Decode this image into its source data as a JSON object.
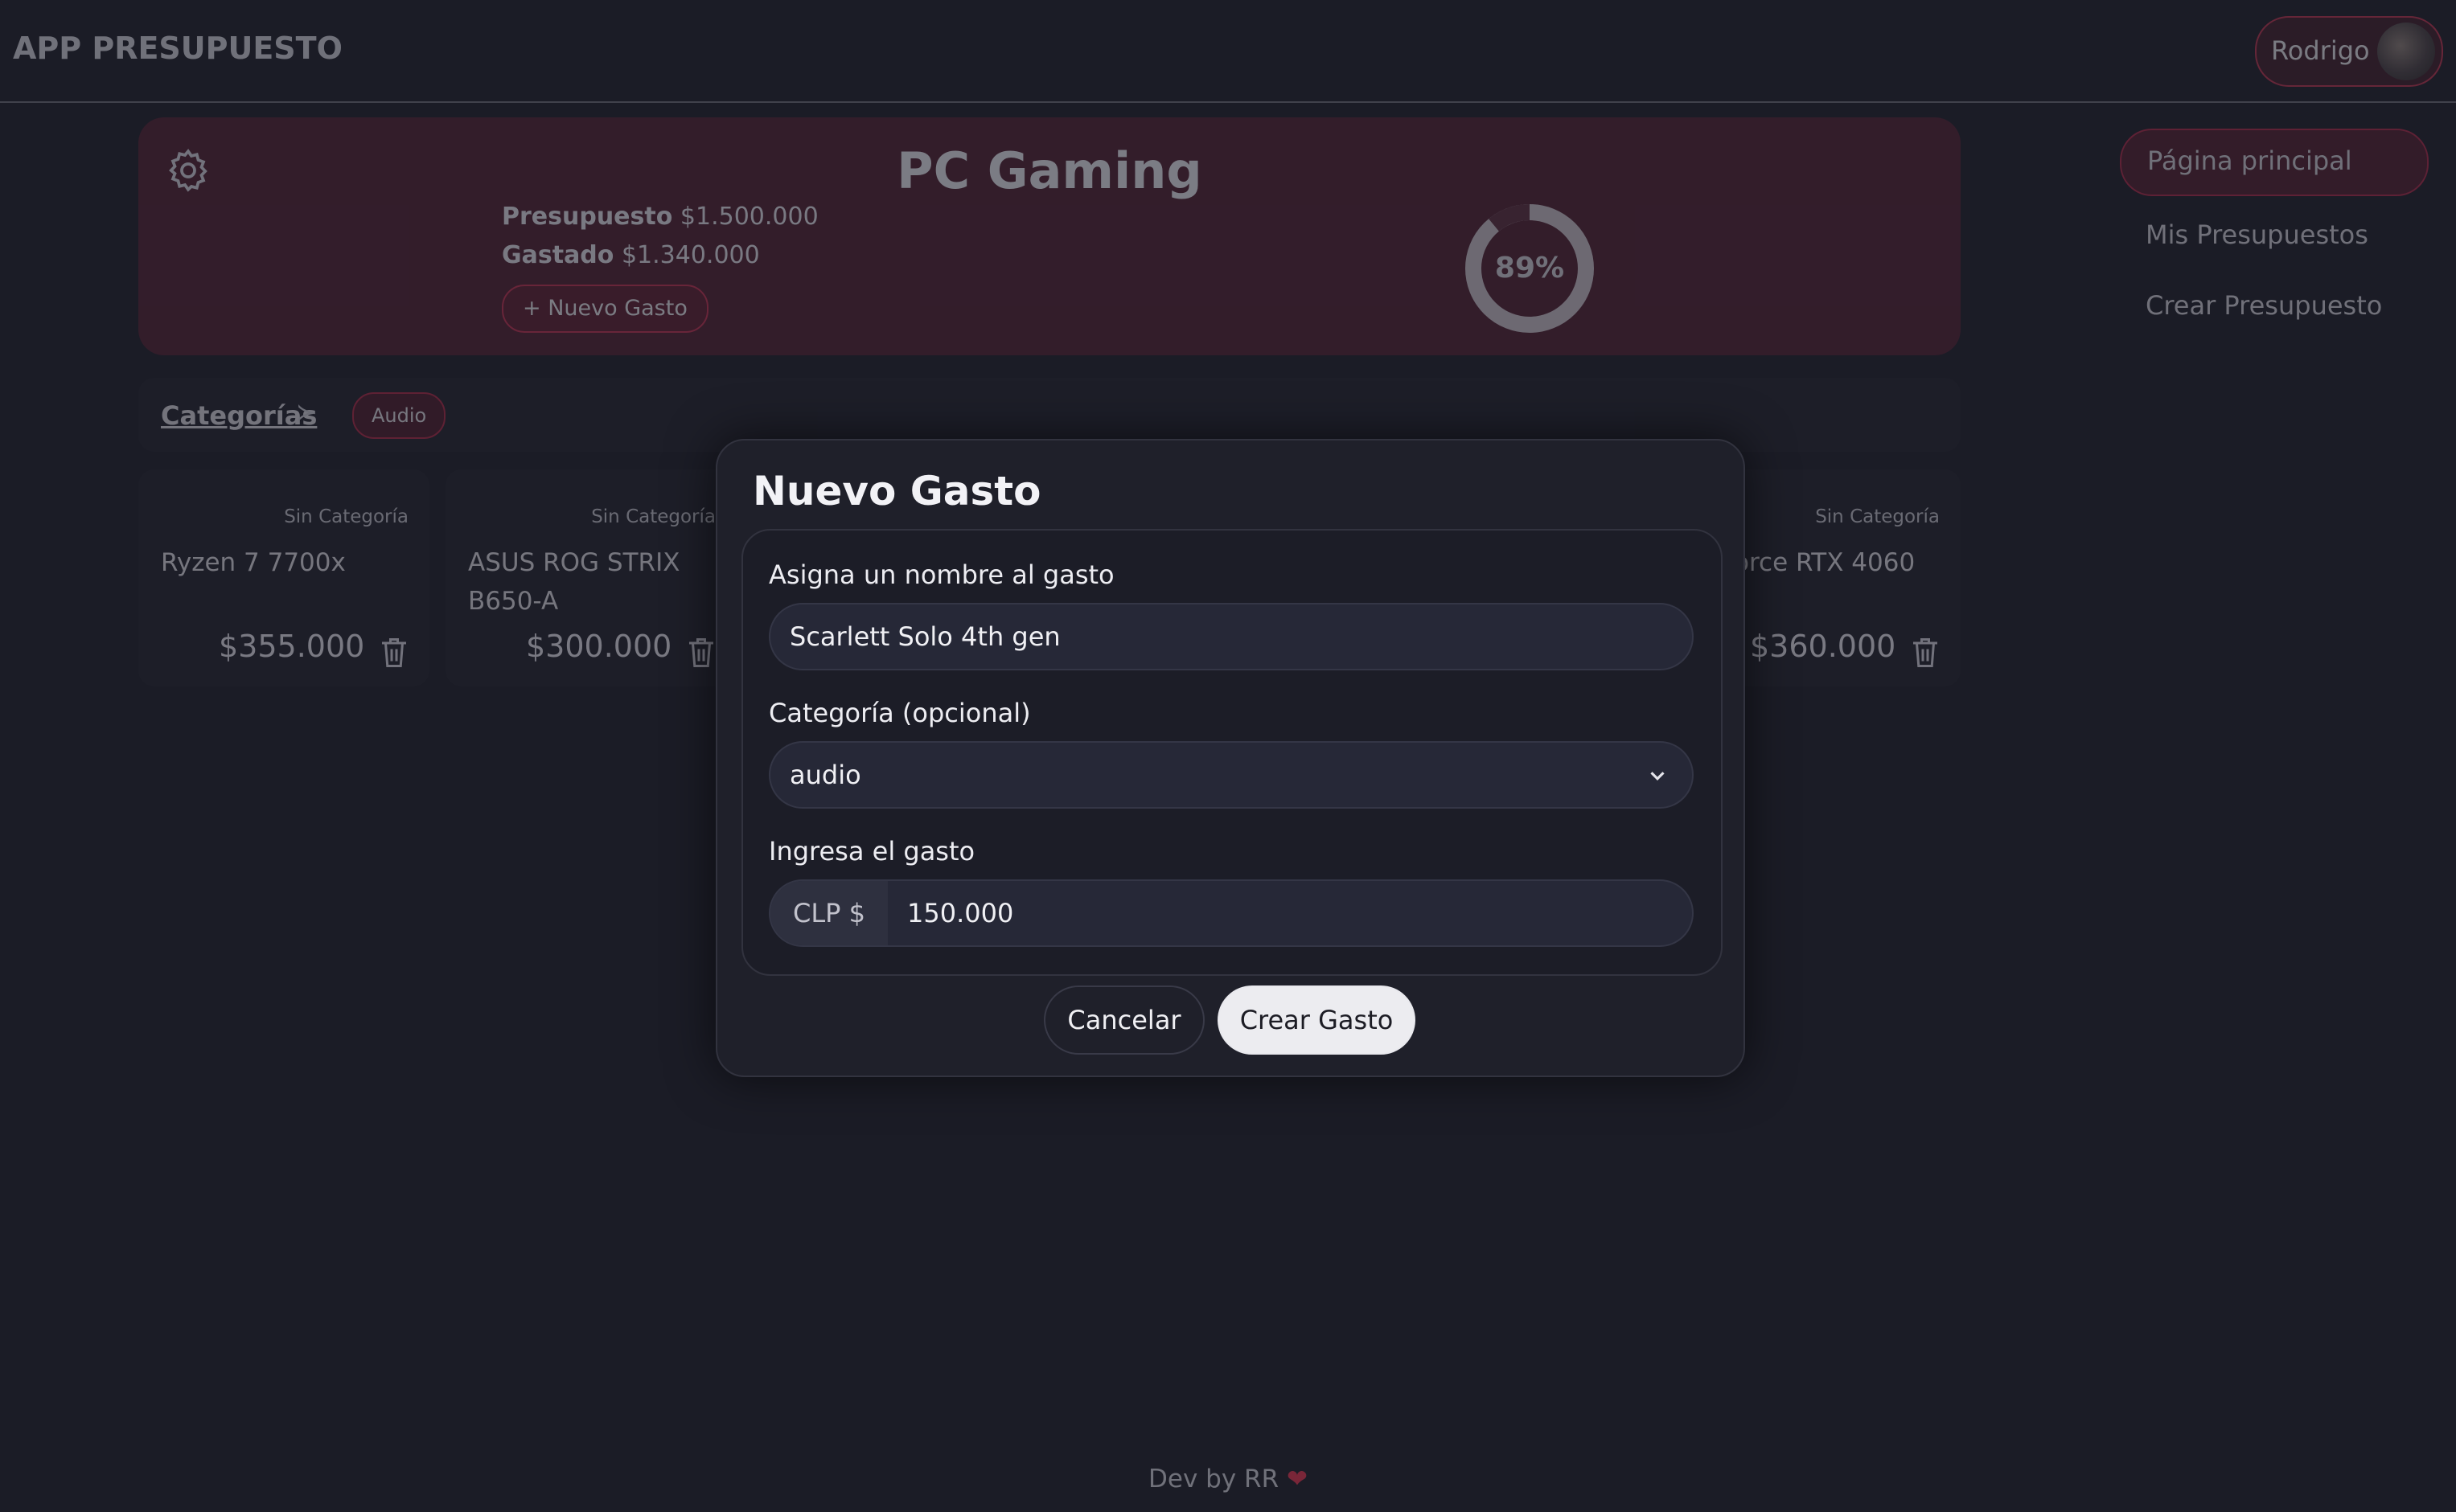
{
  "header": {
    "brand": "APP PRESUPUESTO",
    "user_name": "Rodrigo"
  },
  "budget": {
    "title": "PC Gaming",
    "presupuesto_label": "Presupuesto",
    "presupuesto_value": "$1.500.000",
    "gastado_label": "Gastado",
    "gastado_value": "$1.340.000",
    "new_expense_button": "+ Nuevo Gasto",
    "progress_label": "89%",
    "progress_fraction": 0.89
  },
  "sidebar": {
    "items": [
      {
        "label": "Página principal",
        "active": true
      },
      {
        "label": "Mis Presupuestos",
        "active": false
      },
      {
        "label": "Crear Presupuesto",
        "active": false
      }
    ]
  },
  "categories": {
    "link_label": "Categorías",
    "chips": [
      "Audio"
    ]
  },
  "expenses": [
    {
      "category": "Sin Categoría",
      "name": "Ryzen 7 7700x",
      "amount": "$355.000"
    },
    {
      "category": "Sin Categoría",
      "name": "ASUS ROG STRIX B650-A",
      "amount": "$300.000"
    },
    {
      "category": "Sin Categoría",
      "name": "orce RTX 4060",
      "amount": "$360.000"
    }
  ],
  "modal": {
    "title": "Nuevo Gasto",
    "name_label": "Asigna un nombre al gasto",
    "name_value": "Scarlett Solo 4th gen",
    "category_label": "Categoría (opcional)",
    "category_value": "audio",
    "amount_label": "Ingresa el gasto",
    "currency_prefix": "CLP $",
    "amount_value": "150.000",
    "cancel_button": "Cancelar",
    "create_button": "Crear Gasto"
  },
  "footer": {
    "text": "Dev by RR",
    "heart_icon": "heart-icon"
  },
  "colors": {
    "accent": "#b8324d",
    "background": "#1b1c26",
    "modal": "#1f202a"
  }
}
